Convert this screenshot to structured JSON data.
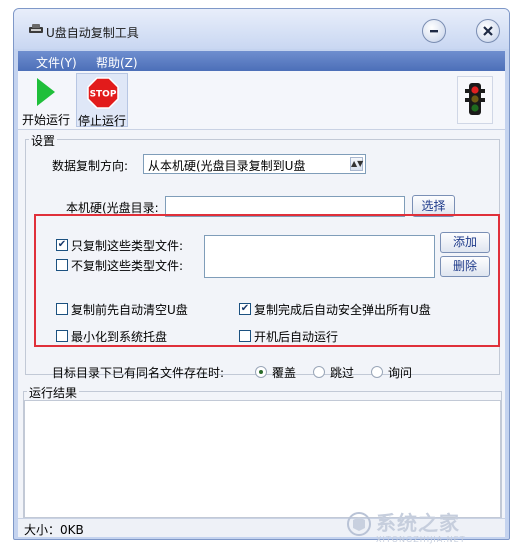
{
  "window": {
    "title": "U盘自动复制工具"
  },
  "menu": {
    "items": [
      {
        "label": "文件(Y)"
      },
      {
        "label": "帮助(Z)"
      }
    ]
  },
  "toolbar": {
    "start_label": "开始运行",
    "stop_label": "停止运行",
    "stop_sign_text": "STOP"
  },
  "settings": {
    "group_title": "设置",
    "direction_label": "数据复制方向:",
    "direction_value": "从本机硬(光盘目录复制到U盘",
    "local_dir_label": "本机硬(光盘目录:",
    "local_dir_value": "",
    "browse_button": "选择",
    "copy_only_types_label": "只复制这些类型文件:",
    "copy_only_types_checked": true,
    "skip_types_label": "不复制这些类型文件:",
    "skip_types_checked": false,
    "types_list_value": "",
    "add_button": "添加",
    "delete_button": "删除",
    "clear_before_copy_label": "复制前先自动清空U盘",
    "clear_before_copy_checked": false,
    "auto_eject_label": "复制完成后自动安全弹出所有U盘",
    "auto_eject_checked": true,
    "minimize_tray_label": "最小化到系统托盘",
    "minimize_tray_checked": false,
    "autorun_label": "开机后自动运行",
    "autorun_checked": false,
    "conflict_label": "目标目录下已有同名文件存在时:",
    "conflict_options": [
      {
        "label": "覆盖",
        "selected": true
      },
      {
        "label": "跳过",
        "selected": false
      },
      {
        "label": "询问",
        "selected": false
      }
    ]
  },
  "results": {
    "group_title": "运行结果",
    "content": ""
  },
  "status": {
    "size_text": "大小：0KB"
  },
  "watermark": {
    "brand": "系统之家",
    "url": "XITONGZHIJIA.NET"
  },
  "colors": {
    "highlight_frame": "#e0303a",
    "menubar": "#4c6fb8",
    "window_frame": "#c4d3ef"
  }
}
